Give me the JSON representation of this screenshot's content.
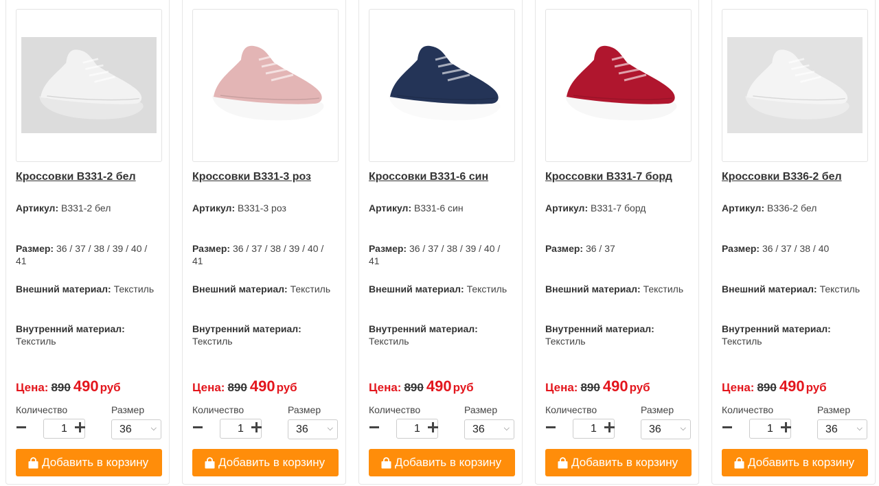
{
  "labels": {
    "article": "Артикул:",
    "size": "Размер:",
    "outer": "Внешний материал:",
    "inner": "Внутренний материал:",
    "price": "Цена:",
    "currency": "руб",
    "quantity": "Количество",
    "size_select": "Размер",
    "add_to_cart": "Добавить в корзину"
  },
  "icons": {
    "minus": "minus-icon",
    "plus": "plus-icon",
    "cart": "shopping-bag-icon",
    "select": "chevron-down-icon"
  },
  "colors": {
    "accent": "#ff8d0a",
    "price_red": "#e3161d"
  },
  "products": [
    {
      "title": "Кроссовки B331-2 бел",
      "article": "B331-2 бел",
      "sizes_line1": "36 / 37 / 38 / 39 / 40 /",
      "sizes_line2": "41",
      "outer": "Текстиль",
      "inner": "Текстиль",
      "old_price": "890",
      "new_price": "490",
      "qty": "1",
      "size": "36",
      "image": {
        "color": "white",
        "upper": "#f2f2f2",
        "sole": "#e8e8e8",
        "bg": "#dcdcdc"
      }
    },
    {
      "title": "Кроссовки B331-3 роз",
      "article": "B331-3 роз",
      "sizes_line1": "36 / 37 / 38 / 39 / 40 /",
      "sizes_line2": "41",
      "outer": "Текстиль",
      "inner": "Текстиль",
      "old_price": "890",
      "new_price": "490",
      "qty": "1",
      "size": "36",
      "image": {
        "color": "pink",
        "upper": "#e3b5b5",
        "sole": "#f7f7f7",
        "bg": "#ffffff"
      }
    },
    {
      "title": "Кроссовки B331-6 син",
      "article": "B331-6 син",
      "sizes_line1": "36 / 37 / 38 / 39 / 40 /",
      "sizes_line2": "41",
      "outer": "Текстиль",
      "inner": "Текстиль",
      "old_price": "890",
      "new_price": "490",
      "qty": "1",
      "size": "36",
      "image": {
        "color": "navy",
        "upper": "#243457",
        "sole": "#fafafa",
        "bg": "#ffffff"
      }
    },
    {
      "title": "Кроссовки B331-7 борд",
      "article": "B331-7 борд",
      "sizes_line1": "36 / 37",
      "sizes_line2": "",
      "outer": "Текстиль",
      "inner": "Текстиль",
      "old_price": "890",
      "new_price": "490",
      "qty": "1",
      "size": "36",
      "image": {
        "color": "burgundy",
        "upper": "#b0162e",
        "sole": "#f7f7f7",
        "bg": "#ffffff"
      }
    },
    {
      "title": "Кроссовки B336-2 бел",
      "article": "B336-2 бел",
      "sizes_line1": "36 / 37 / 38 / 40",
      "sizes_line2": "",
      "outer": "Текстиль",
      "inner": "Текстиль",
      "old_price": "890",
      "new_price": "490",
      "qty": "1",
      "size": "36",
      "image": {
        "color": "white",
        "upper": "#f4f4f4",
        "sole": "#ececec",
        "bg": "#e2e2e2"
      }
    }
  ]
}
